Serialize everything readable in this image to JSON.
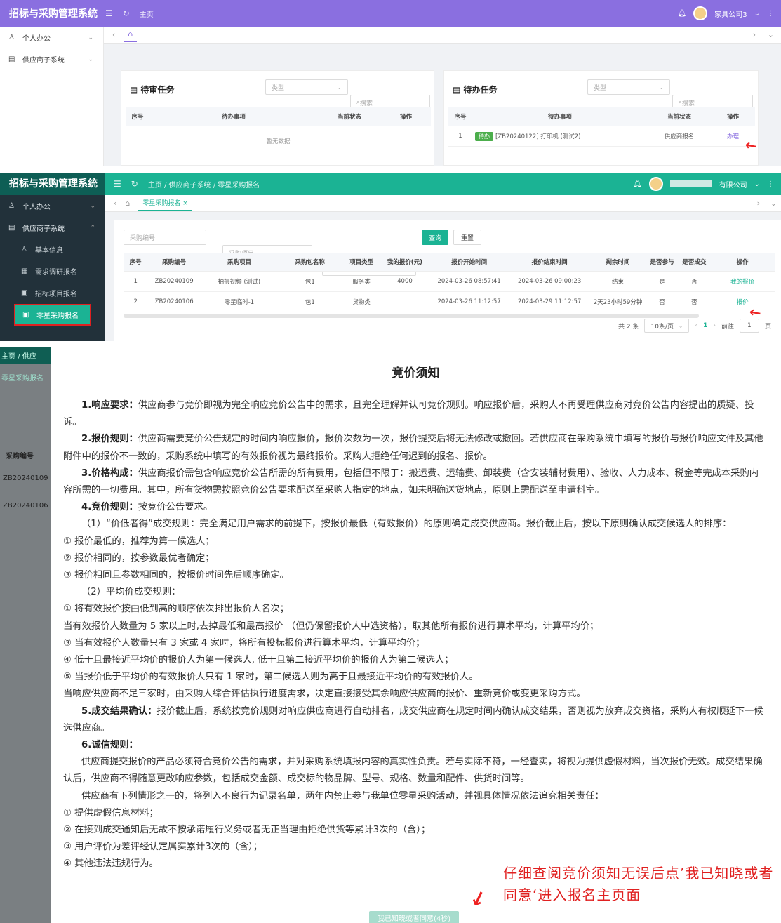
{
  "colors": {
    "purple": "#8a6fe0",
    "teal_dark": "#0e5e55",
    "teal": "#1bb394",
    "sidebar_dark": "#22313a",
    "red": "#e02020"
  },
  "shot1": {
    "brand": "招标与采购管理系统",
    "crumb": "主页",
    "user": "家具公司3",
    "sidebar": [
      {
        "label": "个人办公",
        "icon": "person-icon"
      },
      {
        "label": "供应商子系统",
        "icon": "grid-icon"
      }
    ],
    "pending_review": {
      "title": "待审任务",
      "type_placeholder": "类型",
      "search_placeholder": "搜索",
      "columns": [
        "序号",
        "待办事项",
        "当前状态",
        "操作"
      ],
      "empty": "暂无数据"
    },
    "todo": {
      "title": "待办任务",
      "type_placeholder": "类型",
      "search_placeholder": "搜索",
      "columns": [
        "序号",
        "待办事项",
        "当前状态",
        "操作"
      ],
      "row": {
        "no": "1",
        "tag": "待办",
        "item": "[ZB20240122] 打印机 (测试2)",
        "status": "供应商报名",
        "action": "办理"
      }
    }
  },
  "shot2": {
    "brand": "招标与采购管理系统",
    "crumb": "主页 / 供应商子系统 / 零星采购报名",
    "user": "有限公司",
    "tab": "零星采购报名 ×",
    "sidebar": [
      {
        "label": "个人办公",
        "icon": "person-icon"
      },
      {
        "label": "供应商子系统",
        "icon": "grid-icon"
      },
      {
        "label": "基本信息",
        "icon": "person-icon"
      },
      {
        "label": "需求调研报名",
        "icon": "doc-icon"
      },
      {
        "label": "招标项目报名",
        "icon": "doc-icon"
      },
      {
        "label": "零星采购报名",
        "icon": "doc-icon"
      }
    ],
    "filters": {
      "code": "采购编号",
      "project": "采购项目",
      "all": "全部",
      "query": "查询",
      "reset": "重置"
    },
    "columns": [
      "序号",
      "采购编号",
      "采购项目",
      "采购包名称",
      "项目类型",
      "我的报价(元)",
      "报价开始时间",
      "报价结束时间",
      "剩余时间",
      "是否参与",
      "是否成交",
      "操作"
    ],
    "rows": [
      [
        "1",
        "ZB20240109",
        "拍摄视频 (测试)",
        "包1",
        "服务类",
        "4000",
        "2024-03-26 08:57:41",
        "2024-03-26 09:00:23",
        "结束",
        "是",
        "否",
        "我的报价"
      ],
      [
        "2",
        "ZB20240106",
        "零星临时-1",
        "包1",
        "货物类",
        "",
        "2024-03-26 11:12:57",
        "2024-03-29 11:12:57",
        "2天23小时59分钟",
        "否",
        "否",
        "报价"
      ]
    ],
    "pagination": {
      "total": "共 2 条",
      "size": "10条/页",
      "page": "1",
      "goto": "前往",
      "goto_val": "1",
      "unit": "页"
    }
  },
  "shot3": {
    "bg_crumb": "主页 / 供应",
    "bg_tab": "零星采购报名",
    "bg_col": "采购编号",
    "bg_rows": [
      "ZB20240109",
      "ZB20240106"
    ],
    "title": "竞价须知",
    "paragraphs": [
      {
        "bold": "1.响应要求：",
        "text": "供应商参与竞价即视为完全响应竞价公告中的需求，且完全理解并认可竞价规则。响应报价后，采购人不再受理供应商对竞价公告内容提出的质疑、投诉。",
        "ind": true
      },
      {
        "bold": "2.报价规则：",
        "text": "供应商需要竞价公告规定的时间内响应报价，报价次数为一次，报价提交后将无法修改或撤回。若供应商在采购系统中填写的报价与报价响应文件及其他附件中的报价不一致的，采购系统中填写的有效报价视为最终报价。采购人拒绝任何迟到的报名、报价。",
        "ind": true
      },
      {
        "bold": "3.价格构成：",
        "text": "供应商报价需包含响应竞价公告所需的所有费用，包括但不限于：搬运费、运输费、卸装费（含安装辅材费用）、验收、人力成本、税金等完成本采购内容所需的一切费用。其中，所有货物需按照竞价公告要求配送至采购人指定的地点，如未明确送货地点，原则上需配送至申请科室。",
        "ind": true
      },
      {
        "bold": "4.竞价规则：",
        "text": "按竞价公告要求。",
        "ind": true
      },
      {
        "bold": "",
        "text": "（1）“价低者得”成交规则：完全满足用户需求的前提下，按报价最低（有效报价）的原则确定成交供应商。报价截止后，按以下原则确认成交候选人的排序：",
        "ind": true
      },
      {
        "bold": "",
        "text": "① 报价最低的，推荐为第一候选人；",
        "ind": false
      },
      {
        "bold": "",
        "text": "② 报价相同的，按参数最优者确定；",
        "ind": false
      },
      {
        "bold": "",
        "text": "③ 报价相同且参数相同的，按报价时间先后顺序确定。",
        "ind": false
      },
      {
        "bold": "",
        "text": "（2）平均价成交规则：",
        "ind": true
      },
      {
        "bold": "",
        "text": "① 将有效报价按由低到高的顺序依次排出报价人名次；",
        "ind": false
      },
      {
        "bold": "",
        "text": "当有效报价人数量为 5 家以上时,去掉最低和最高报价 （但仍保留报价人中选资格），取其他所有报价进行算术平均，计算平均价；",
        "ind": false
      },
      {
        "bold": "",
        "text": "③ 当有效报价人数量只有 3 家或 4 家时，将所有投标报价进行算术平均，计算平均价；",
        "ind": false
      },
      {
        "bold": "",
        "text": "④ 低于且最接近平均价的报价人为第一候选人, 低于且第二接近平均价的报价人为第二候选人；",
        "ind": false
      },
      {
        "bold": "",
        "text": "⑤ 当报价低于平均价的有效报价人只有 1 家时，第二候选人则为高于且最接近平均价的有效报价人。",
        "ind": false
      },
      {
        "bold": "",
        "text": "当响应供应商不足三家时，由采购人综合评估执行进度需求，决定直接接受其余响应供应商的报价、重新竞价或变更采购方式。",
        "ind": false
      },
      {
        "bold": "5.成交结果确认：",
        "text": "报价截止后，系统按竞价规则对响应供应商进行自动排名，成交供应商在规定时间内确认成交结果，否则视为放弃成交资格，采购人有权顺延下一候选供应商。",
        "ind": true
      },
      {
        "bold": "6.诚信规则：",
        "text": "",
        "ind": true
      },
      {
        "bold": "",
        "text": "供应商提交报价的产品必须符合竞价公告的需求，并对采购系统填报内容的真实性负责。若与实际不符，一经查实，将视为提供虚假材料，当次报价无效。成交结果确认后，供应商不得随意更改响应参数，包括成交金额、成交标的物品牌、型号、规格、数量和配件、供货时间等。",
        "ind": true
      },
      {
        "bold": "",
        "text": "供应商有下列情形之一的，将列入不良行为记录名单，两年内禁止参与我单位零星采购活动，并视具体情况依法追究相关责任：",
        "ind": true
      },
      {
        "bold": "",
        "text": "① 提供虚假信息材料；",
        "ind": false
      },
      {
        "bold": "",
        "text": "② 在接到成交通知后无故不按承诺履行义务或者无正当理由拒绝供货等累计3次的（含）；",
        "ind": false
      },
      {
        "bold": "",
        "text": "③ 用户评价为差评经认定属实累计3次的（含）；",
        "ind": false
      },
      {
        "bold": "",
        "text": "④ 其他违法违规行为。",
        "ind": false
      }
    ],
    "annotation": "仔细查阅竞价须知无误后点’我已知晓或者同意‘进入报名主页面",
    "agree_button": "我已知晓或者同意(4秒)"
  }
}
